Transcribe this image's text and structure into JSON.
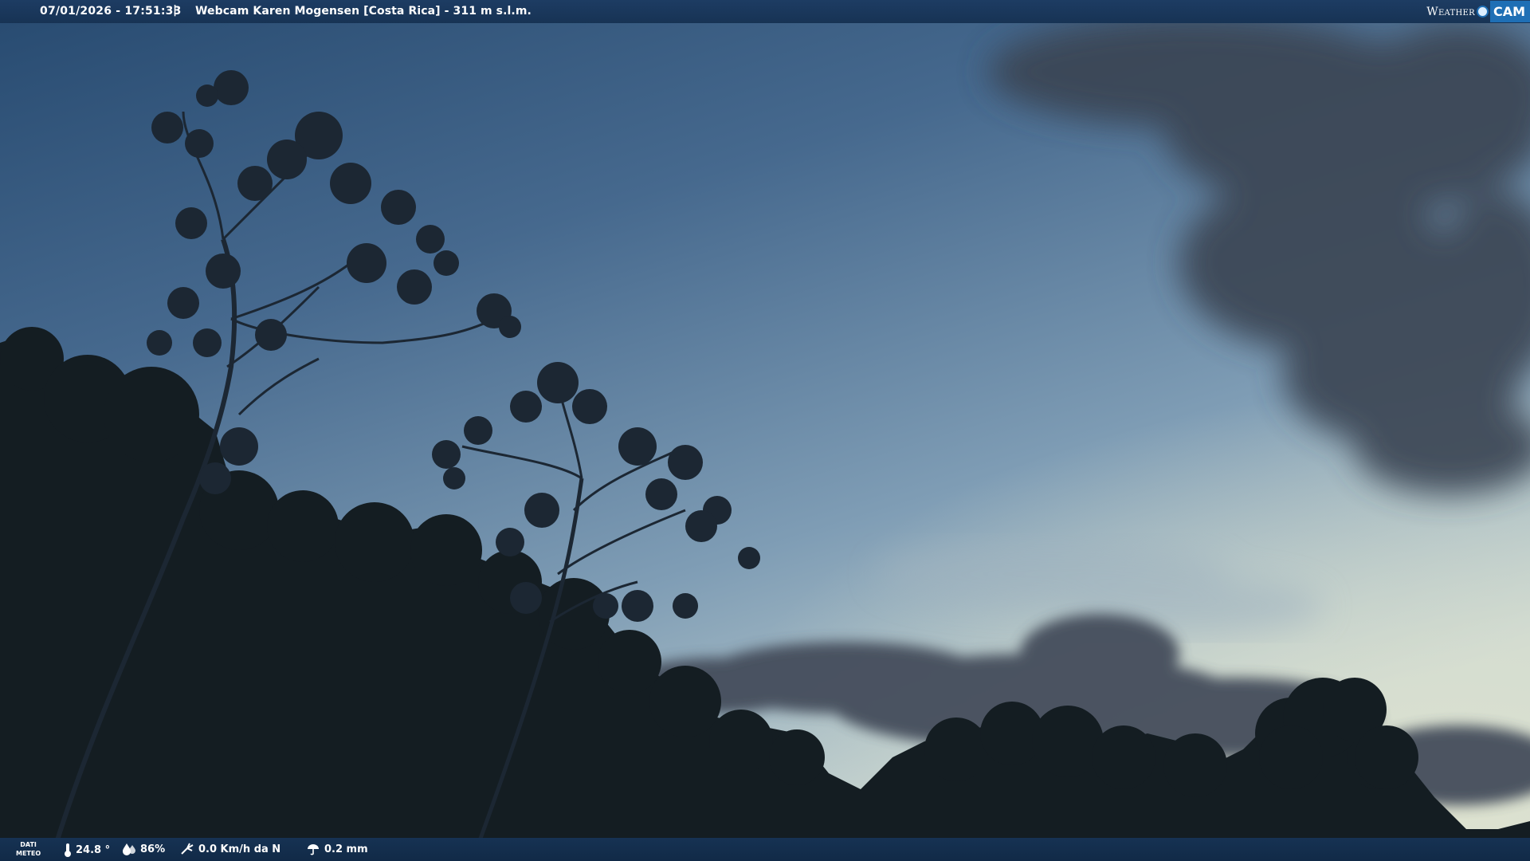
{
  "header": {
    "datetime": "07/01/2026 - 17:51:33",
    "separator": "|",
    "title": "Webcam Karen Mogensen [Costa Rica]  -  311 m s.l.m."
  },
  "logo": {
    "word": "Weather",
    "cam": "CAM"
  },
  "weather": {
    "label_line1": "DATI",
    "label_line2": "METEO",
    "temperature": "24.8 °",
    "humidity": "86%",
    "wind": "0.0 Km/h da N",
    "rain": "0.2 mm"
  },
  "colors": {
    "sky_top": "#2f5276",
    "sky_mid": "#6d8eab",
    "sky_horizon": "#c9d7d6",
    "bar_bg": "#173354",
    "logo_blue": "#1f6fb5"
  },
  "icons": [
    "thermometer-icon",
    "humidity-drop-icon",
    "wind-icon",
    "rain-icon"
  ]
}
